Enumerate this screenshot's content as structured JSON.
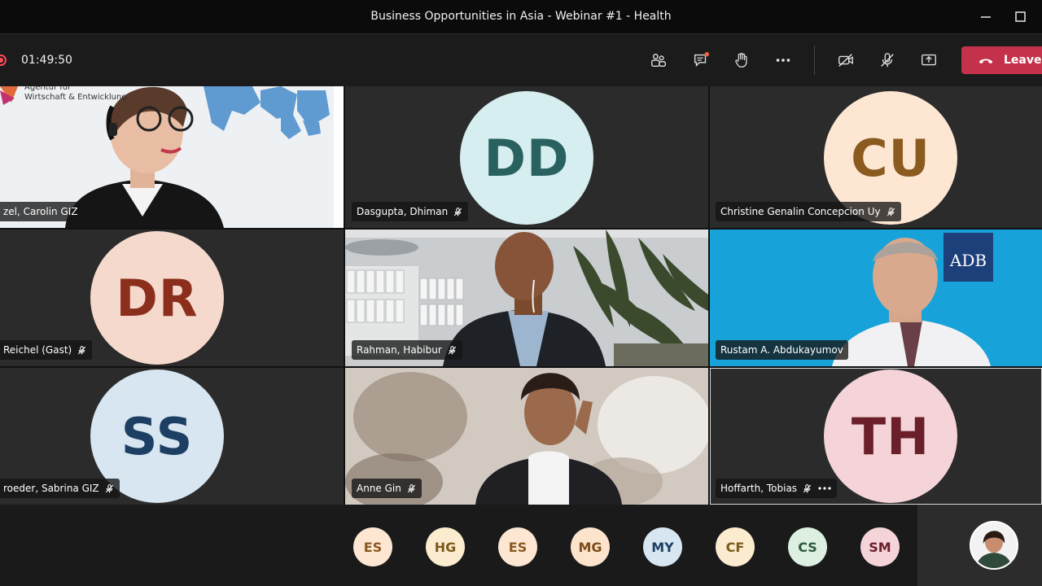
{
  "window": {
    "title": "Business Opportunities in Asia - Webinar #1 - Health"
  },
  "toolbar": {
    "timer": "01:49:50",
    "leave_label": "Leave"
  },
  "tiles": {
    "t1": {
      "name": "zel, Carolin GIZ",
      "logo_line1": "Agentur für",
      "logo_line2": "Wirtschaft & Entwicklung"
    },
    "t2": {
      "name": "Dasgupta, Dhiman",
      "initials": "DD"
    },
    "t3": {
      "name": "Christine Genalin Concepcion Uy",
      "initials": "CU"
    },
    "t4": {
      "name": "Reichel (Gast)",
      "initials": "DR"
    },
    "t5": {
      "name": "Rahman, Habibur"
    },
    "t6": {
      "name": "Rustam A. Abdukayumov",
      "logo": "ADB"
    },
    "t7": {
      "name": "roeder, Sabrina GIZ",
      "initials": "SS"
    },
    "t8": {
      "name": "Anne Gin"
    },
    "t9": {
      "name": "Hoffarth, Tobias",
      "initials": "TH"
    }
  },
  "bottom_bar": {
    "participants": [
      "ES",
      "HG",
      "ES",
      "MG",
      "MY",
      "CF",
      "CS",
      "SM"
    ]
  },
  "colors": {
    "leave": "#c4314b",
    "dd_bg": "#d7eef0",
    "dd_fg": "#28615f",
    "cu_bg": "#fde7d3",
    "cu_fg": "#8a5a1e",
    "dr_bg": "#f6d9cd",
    "dr_fg": "#8b2f1c",
    "ss_bg": "#d8e6f2",
    "ss_fg": "#1c3f63",
    "th_bg": "#f4d4d8",
    "th_fg": "#6b1f2b"
  }
}
